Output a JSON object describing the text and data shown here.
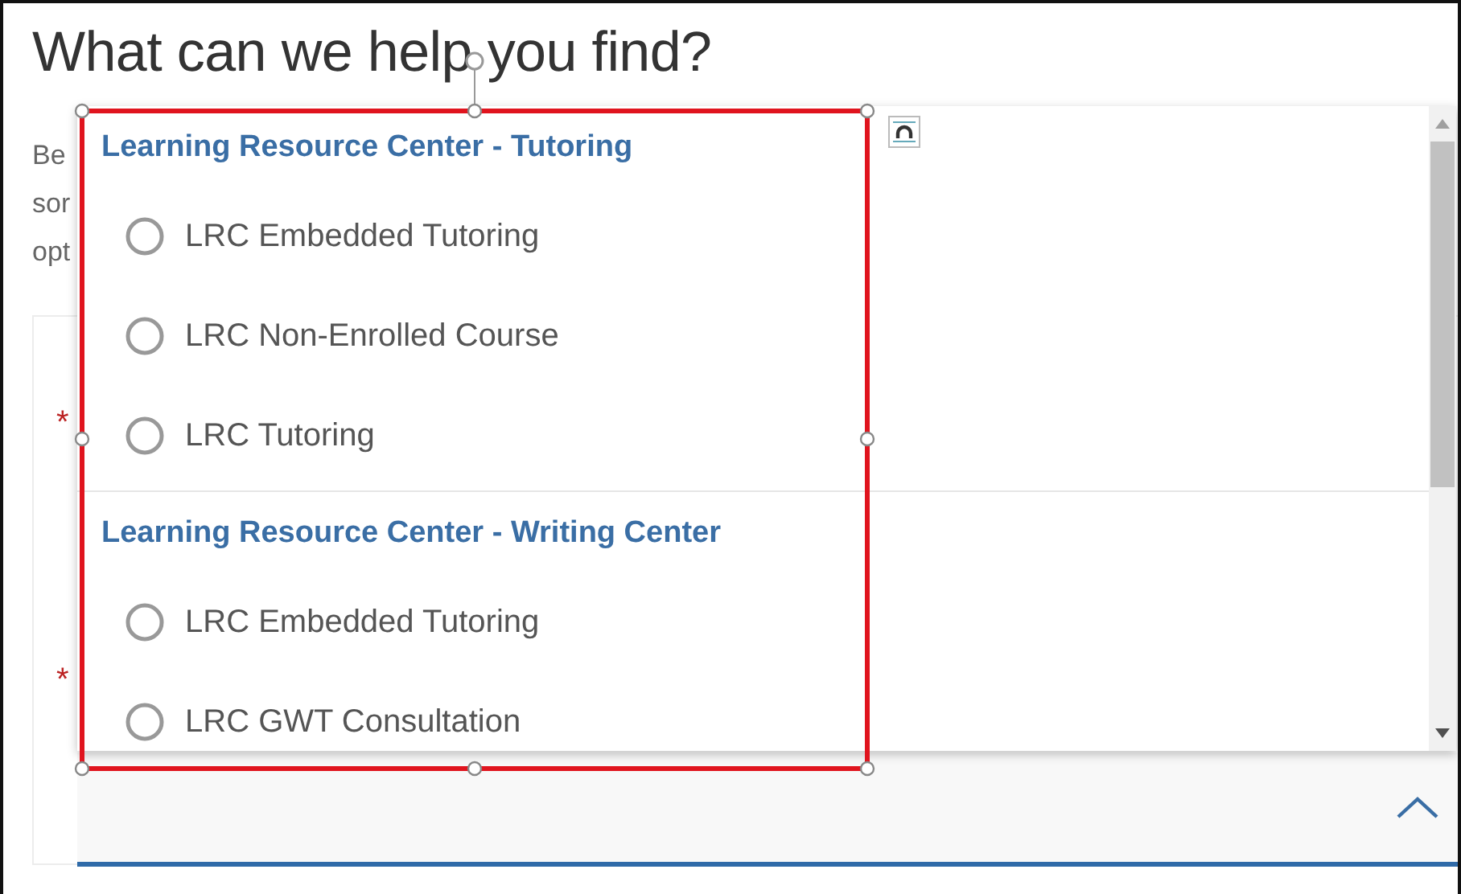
{
  "heading": "What can we help you find?",
  "intro_lines": [
    "Be",
    "sor",
    "opt"
  ],
  "required_marks": [
    "*",
    "*"
  ],
  "dropdown": {
    "groups": [
      {
        "title": "Learning Resource Center - Tutoring",
        "options": [
          {
            "label": "LRC Embedded Tutoring",
            "selected": false
          },
          {
            "label": "LRC Non-Enrolled Course",
            "selected": false
          },
          {
            "label": "LRC Tutoring",
            "selected": false
          }
        ]
      },
      {
        "title": "Learning Resource Center - Writing Center",
        "options": [
          {
            "label": "LRC Embedded Tutoring",
            "selected": false
          },
          {
            "label": "LRC GWT Consultation",
            "selected": false
          }
        ]
      }
    ]
  }
}
